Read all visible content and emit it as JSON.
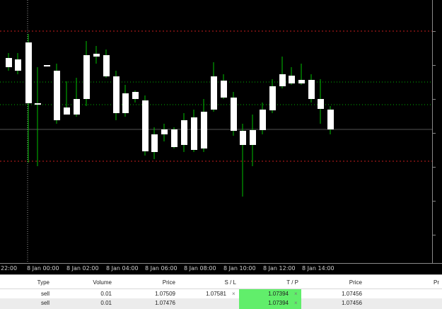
{
  "chart": {
    "time_labels": [
      "22:00",
      "8 Jan 00:00",
      "8 Jan 02:00",
      "8 Jan 04:00",
      "8 Jan 06:00",
      "8 Jan 08:00",
      "8 Jan 10:00",
      "8 Jan 12:00",
      "8 Jan 14:00"
    ],
    "colors": {
      "background": "#000000",
      "bull_candle": "#ffffff",
      "wick": "#00c000",
      "red_level": "#c81e1e",
      "green_level": "#00b400",
      "grid": "#555555"
    }
  },
  "trades": {
    "headers": {
      "type": "Type",
      "volume": "Volume",
      "price": "Price",
      "sl": "S / L",
      "tp": "T / P",
      "price2": "Price",
      "pr": "Pr"
    },
    "rows": [
      {
        "type": "sell",
        "volume": "0.01",
        "price": "1.07509",
        "sl": "1.07581",
        "tp": "1.07394",
        "price2": "1.07456"
      },
      {
        "type": "sell",
        "volume": "0.01",
        "price": "1.07476",
        "sl": "",
        "tp": "1.07394",
        "price2": "1.07456"
      }
    ],
    "close_icon": "x-icon"
  }
}
